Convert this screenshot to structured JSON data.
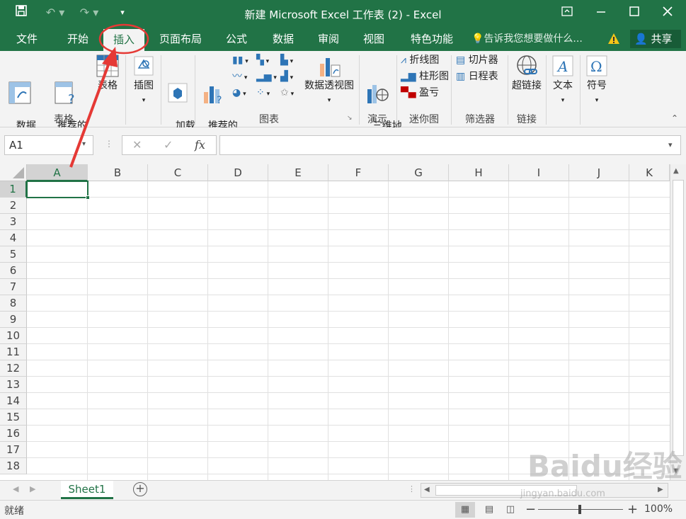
{
  "window": {
    "title": "新建 Microsoft Excel 工作表 (2) - Excel"
  },
  "tabs": [
    "文件",
    "开始",
    "插入",
    "页面布局",
    "公式",
    "数据",
    "审阅",
    "视图",
    "特色功能"
  ],
  "active_tab": "插入",
  "tell_me": "告诉我您想要做什么...",
  "share_label": "共享",
  "ribbon": {
    "pivot_table": "数据\n透视表",
    "recommended_pivot": "推荐的\n数据透视表",
    "table": "表格",
    "illustrations": "插图",
    "addins": "加载\n项",
    "recommended_charts": "推荐的\n图表",
    "pivot_chart": "数据透视图",
    "map_3d": "三维地\n图",
    "line": "折线图",
    "column": "柱形图",
    "winloss": "盈亏",
    "slicer": "切片器",
    "timeline": "日程表",
    "hyperlink": "超链接",
    "text": "文本",
    "symbol": "符号",
    "groups": [
      "表格",
      "图表",
      "演示",
      "迷你图",
      "筛选器",
      "链接"
    ]
  },
  "namebox": "A1",
  "fx": "fx",
  "columns": [
    "A",
    "B",
    "C",
    "D",
    "E",
    "F",
    "G",
    "H",
    "I",
    "J",
    "K"
  ],
  "rows": [
    "1",
    "2",
    "3",
    "4",
    "5",
    "6",
    "7",
    "8",
    "9",
    "10",
    "11",
    "12",
    "13",
    "14",
    "15",
    "16",
    "17",
    "18"
  ],
  "sheet_tab": "Sheet1",
  "status": {
    "ready": "就绪",
    "zoom": "100%"
  },
  "watermark": {
    "brand": "Baidu经验",
    "url": "jingyan.baidu.com"
  },
  "colors": {
    "accent": "#217346",
    "annotation": "#e53935"
  }
}
